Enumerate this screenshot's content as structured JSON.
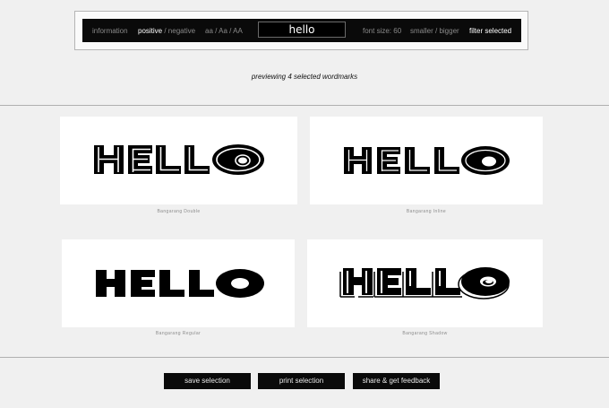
{
  "toolbar": {
    "information": "information",
    "positive": "positive",
    "posneg_sep": " / ",
    "negative": "negative",
    "case_lower": "aa",
    "case_sep1": " / ",
    "case_title": "Aa",
    "case_sep2": " / ",
    "case_upper": "AA",
    "preview_text": "hello",
    "font_size_label": "font size: 60",
    "smaller": "smaller",
    "scale_sep": " / ",
    "bigger": "bigger",
    "filter_selected": "filter selected"
  },
  "subtitle": "previewing 4 selected wordmarks",
  "wordmarks": [
    {
      "caption": "Bangarang Double"
    },
    {
      "caption": "Bangarang Inline"
    },
    {
      "caption": "Bangarang Regular"
    },
    {
      "caption": "Bangarang Shadow"
    }
  ],
  "actions": {
    "save": "save selection",
    "print": "print selection",
    "share": "share & get feedback"
  },
  "colors": {
    "background": "#f0f0f0",
    "toolbar": "#0a0a0a",
    "toolbar_active_text": "#ffffff",
    "toolbar_inactive_text": "#8a8a8a",
    "card": "#ffffff"
  }
}
